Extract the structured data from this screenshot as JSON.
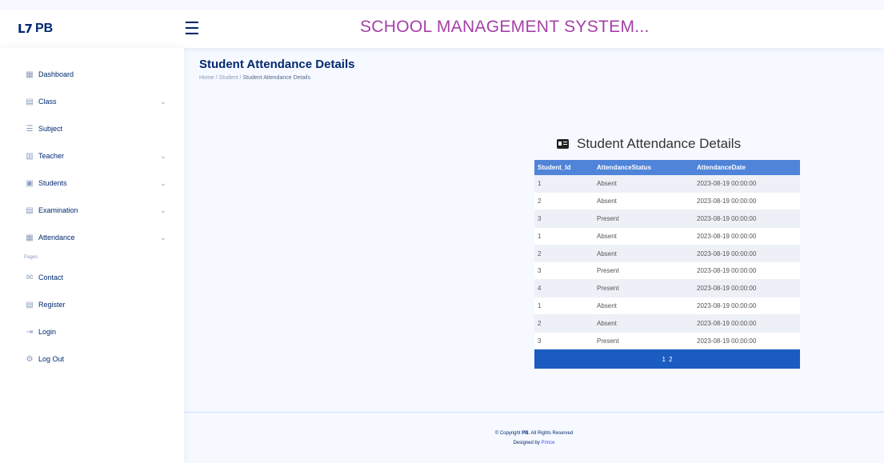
{
  "header": {
    "logo_mark": "L7",
    "logo_text": "PB",
    "toggle_icon": "☰",
    "title": "SCHOOL MANAGEMENT SYSTEM..."
  },
  "sidebar": {
    "items": [
      {
        "label": "Dashboard",
        "icon": "grid-icon",
        "glyph": "▦",
        "chevron": false
      },
      {
        "label": "Class",
        "icon": "class-icon",
        "glyph": "▤",
        "chevron": true
      },
      {
        "label": "Subject",
        "icon": "subject-icon",
        "glyph": "☰",
        "chevron": false
      },
      {
        "label": "Teacher",
        "icon": "teacher-icon",
        "glyph": "▥",
        "chevron": true
      },
      {
        "label": "Students",
        "icon": "students-icon",
        "glyph": "▣",
        "chevron": true
      },
      {
        "label": "Examination",
        "icon": "examination-icon",
        "glyph": "▤",
        "chevron": true
      },
      {
        "label": "Attendance",
        "icon": "attendance-icon",
        "glyph": "▦",
        "chevron": true
      }
    ],
    "heading": "Pages",
    "pages": [
      {
        "label": "Contact",
        "icon": "envelope-icon",
        "glyph": "✉"
      },
      {
        "label": "Register",
        "icon": "register-icon",
        "glyph": "▤"
      },
      {
        "label": "Login",
        "icon": "login-icon",
        "glyph": "⇥"
      },
      {
        "label": "Log Out",
        "icon": "gear-icon",
        "glyph": "⚙"
      }
    ],
    "chevron_glyph": "⌄"
  },
  "main": {
    "page_title": "Student Attendance Details",
    "breadcrumb": {
      "home": "Home",
      "sep": " / ",
      "student": "Student",
      "current": "Student Attendance Details"
    }
  },
  "table": {
    "title": "Student Attendance Details",
    "title_icon": "person-card-icon",
    "columns": [
      "Student_Id",
      "AttendanceStatus",
      "AttendanceDate"
    ],
    "rows": [
      [
        "1",
        "Absent",
        "2023-08-19 00:00:00"
      ],
      [
        "2",
        "Absent",
        "2023-08-19 00:00:00"
      ],
      [
        "3",
        "Present",
        "2023-08-19 00:00:00"
      ],
      [
        "1",
        "Absent",
        "2023-08-19 00:00:00"
      ],
      [
        "2",
        "Absent",
        "2023-08-19 00:00:00"
      ],
      [
        "3",
        "Present",
        "2023-08-19 00:00:00"
      ],
      [
        "4",
        "Present",
        "2023-08-19 00:00:00"
      ],
      [
        "1",
        "Absent",
        "2023-08-19 00:00:00"
      ],
      [
        "2",
        "Absent",
        "2023-08-19 00:00:00"
      ],
      [
        "3",
        "Present",
        "2023-08-19 00:00:00"
      ]
    ],
    "pager": [
      "1",
      "2"
    ]
  },
  "footer": {
    "copyright_prefix": "© Copyright ",
    "brand": "PB",
    "copyright_suffix": ". All Rights Reserved",
    "designed_prefix": "Designed by ",
    "designer": "Prince"
  },
  "colors": {
    "accent": "#012970",
    "title": "#a53fa8",
    "table_header": "#4f84d9",
    "pager": "#1a5cbf"
  }
}
